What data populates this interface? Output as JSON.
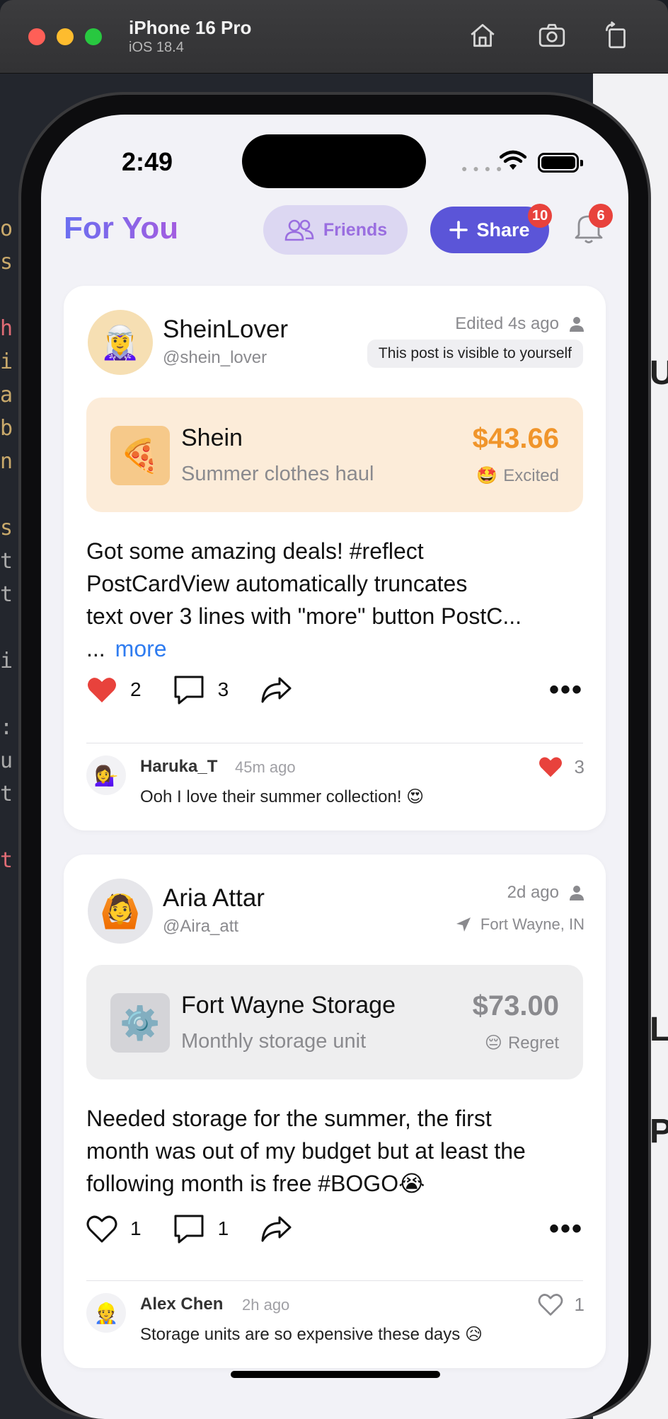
{
  "simulator": {
    "device_name": "iPhone 16 Pro",
    "os_version": "iOS 18.4",
    "home_icon": "home-icon",
    "screenshot_icon": "camera-icon",
    "rotate_icon": "rotate-icon"
  },
  "status_bar": {
    "time": "2:49"
  },
  "header": {
    "title": "For You",
    "friends_label": "Friends",
    "share_label": "Share",
    "share_badge": "10",
    "notifications_badge": "6"
  },
  "posts": [
    {
      "user_name": "SheinLover",
      "handle": "@shein_lover",
      "avatar": "🧝‍♀️",
      "timestamp": "Edited 4s ago",
      "visibility": "This post is visible to yourself",
      "purchase": {
        "icon": "🍕",
        "store": "Shein",
        "description": "Summer clothes haul",
        "price": "$43.66",
        "mood_emoji": "🤩",
        "mood": "Excited"
      },
      "body_lines": [
        "Got some amazing deals! #reflect",
        "PostCardView automatically truncates",
        "text over 3 lines with \"more\" button PostC...",
        "..."
      ],
      "more_label": "more",
      "likes": "2",
      "comments": "3",
      "liked": true,
      "top_comment": {
        "avatar": "💁‍♀️",
        "name": "Haruka_T",
        "time": "45m ago",
        "text": "Ooh I love their summer collection! 😍",
        "likes": "3",
        "liked": true
      }
    },
    {
      "user_name": "Aria Attar",
      "handle": "@Aira_att",
      "avatar": "🙆",
      "timestamp": "2d ago",
      "location": "Fort Wayne, IN",
      "purchase": {
        "icon": "⚙️",
        "store": "Fort Wayne Storage",
        "description": "Monthly storage unit",
        "price": "$73.00",
        "mood_emoji": "😔",
        "mood": "Regret"
      },
      "body_lines": [
        "Needed storage for the summer, the first",
        "month was out of my budget but at least the",
        "following month is free #BOGO😭"
      ],
      "likes": "1",
      "comments": "1",
      "liked": false,
      "top_comment": {
        "avatar": "👷",
        "name": "Alex Chen",
        "time": "2h ago",
        "text": "Storage units are so expensive these days 😥",
        "likes": "1",
        "liked": false
      }
    }
  ],
  "colors": {
    "accent": "#5b55d8",
    "like_red": "#e8423c",
    "price_orange": "#f0952b",
    "price_gray": "#8a8a8e",
    "shein_bg": "#fcecd9",
    "storage_bg": "#eeeeef"
  }
}
